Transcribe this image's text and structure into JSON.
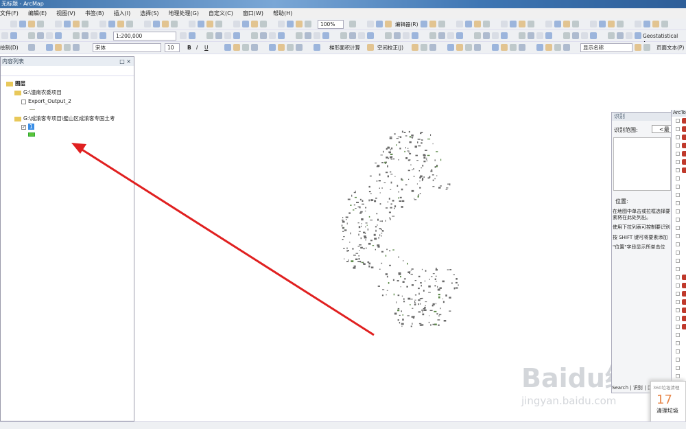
{
  "window": {
    "title": "无标题 - ArcMap"
  },
  "menu": [
    "文件(F)",
    "编辑(E)",
    "视图(V)",
    "书签(B)",
    "插入(I)",
    "选择(S)",
    "地理处理(G)",
    "自定义(C)",
    "窗口(W)",
    "帮助(H)"
  ],
  "toolbar": {
    "zoom_level": "100%",
    "editor": "编辑器(R)",
    "scale": "1:200,000",
    "geostat": "Geostatistical Ana",
    "draw": "绘制(D)",
    "font": "宋体",
    "font_size": "10",
    "bold": "B",
    "italic": "I",
    "underline": "U",
    "calc": "梯形面积计算",
    "spatial_adjust": "空间校正(J)",
    "display_name": "显示名称",
    "page_text": "页面文本(P)"
  },
  "toc": {
    "title": "内容列表",
    "root": "图层",
    "group1": "G:\\潼南农委项目",
    "layer1": "Export_Output_2",
    "group2": "G:\\成渝客专项目\\璧山区成渝客专国土考",
    "layer2": "1"
  },
  "identify": {
    "title": "识别",
    "range_label": "识别范围:",
    "range_value": "<最",
    "location_label": "位置:",
    "hint1": "在地图中单击或拉框选择要素将在此处列出。",
    "hint2": "使用下拉列表可控制要识别",
    "hint3": "按 SHIFT 键可将要素添加",
    "hint4": "\"位置\"字段显示所单击位",
    "tab": "Search | 识别 | 目录"
  },
  "arctoolbox": {
    "title": "ArcToolbox"
  },
  "popup": {
    "title": "360垃圾清理",
    "number": "17",
    "action": "清理垃圾"
  },
  "watermark": {
    "text": "Baidu经验",
    "url": "jingyan.baidu.com"
  },
  "colors": {
    "arrow": "#e02020",
    "layer_fill": "#5ac43a",
    "map_feature": "#6a6a6a"
  }
}
